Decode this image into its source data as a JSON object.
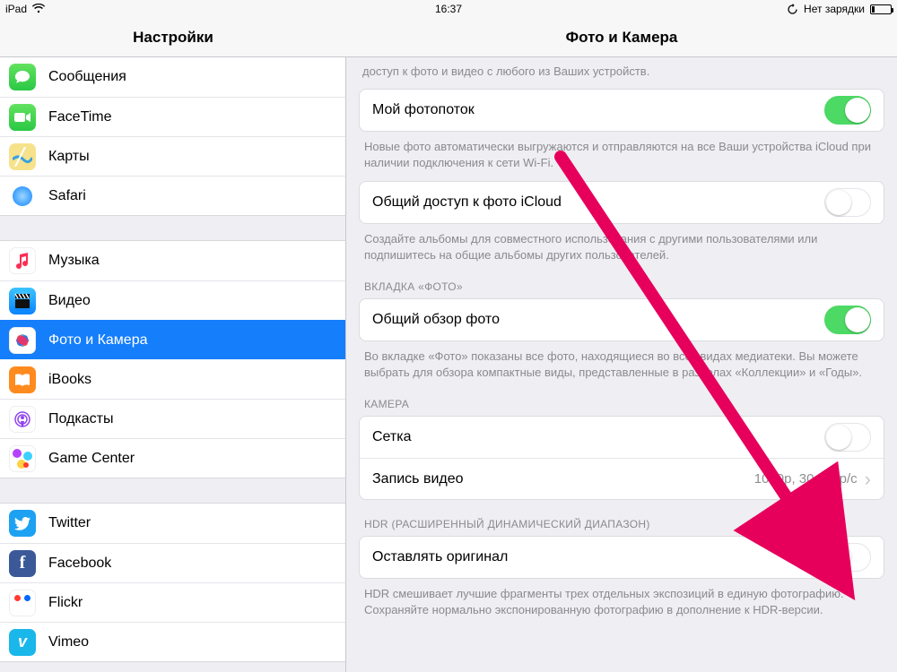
{
  "statusbar": {
    "device": "iPad",
    "time": "16:37",
    "charging_label": "Нет зарядки"
  },
  "headers": {
    "left_title": "Настройки",
    "right_title": "Фото и Камера"
  },
  "sidebar": {
    "group1": [
      {
        "label": "Сообщения"
      },
      {
        "label": "FaceTime"
      },
      {
        "label": "Карты"
      },
      {
        "label": "Safari"
      }
    ],
    "group2": [
      {
        "label": "Музыка"
      },
      {
        "label": "Видео"
      },
      {
        "label": "Фото и Камера"
      },
      {
        "label": "iBooks"
      },
      {
        "label": "Подкасты"
      },
      {
        "label": "Game Center"
      }
    ],
    "group3": [
      {
        "label": "Twitter"
      },
      {
        "label": "Facebook"
      },
      {
        "label": "Flickr"
      },
      {
        "label": "Vimeo"
      }
    ]
  },
  "detail": {
    "intro_tail": "доступ к фото и видео с любого из Ваших устройств.",
    "photostream": {
      "label": "Мой фотопоток",
      "on": true,
      "footnote": "Новые фото автоматически выгружаются и отправляются на все Ваши устройства iCloud при наличии подключения к сети Wi-Fi."
    },
    "icloud_sharing": {
      "label": "Общий доступ к фото iCloud",
      "on": false,
      "footnote": "Создайте альбомы для совместного использования с другими пользователями или подпишитесь на общие альбомы других пользователей."
    },
    "photos_tab": {
      "header": "ВКЛАДКА «ФОТО»",
      "summary_label": "Общий обзор фото",
      "summary_on": true,
      "footnote": "Во вкладке «Фото» показаны все фото, находящиеся во всех видах медиатеки. Вы можете выбрать для обзора компактные виды, представленные в разделах «Коллекции» и «Годы»."
    },
    "camera": {
      "header": "КАМЕРА",
      "grid_label": "Сетка",
      "grid_on": false,
      "video_label": "Запись видео",
      "video_value": "1080p, 30 кадр/с"
    },
    "hdr": {
      "header": "HDR (РАСШИРЕННЫЙ ДИНАМИЧЕСКИЙ ДИАПАЗОН)",
      "keep_label": "Оставлять оригинал",
      "keep_on": false,
      "footnote": "HDR смешивает лучшие фрагменты трех отдельных экспозиций в единую фотографию. Сохраняйте нормально экспонированную фотографию в дополнение к HDR-версии."
    }
  }
}
